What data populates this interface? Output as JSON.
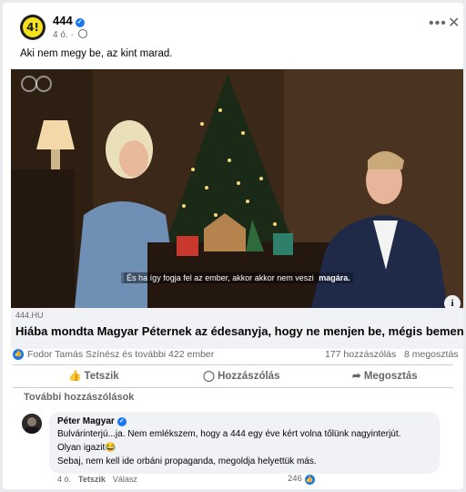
{
  "post": {
    "page_name": "444",
    "time": "4 ó.",
    "caption": "Aki nem megy be, az kint marad.",
    "logo_text": "4!",
    "more_icon": "more-dots-icon",
    "close_icon": "close-icon"
  },
  "media": {
    "subtitle_text": "És ha így fogja fel az ember, akkor akkor nem veszi ",
    "subtitle_emph": "magára."
  },
  "link": {
    "domain": "444.HU",
    "headline": "Hiába mondta Magyar Péternek az édesanyja, hogy ne menjen be, mégis bement"
  },
  "stats": {
    "reactors": "Fodor Tamás Színész és további 422 ember",
    "comments": "177 hozzászólás",
    "shares": "8 megosztás"
  },
  "actions": {
    "like": "Tetszik",
    "comment": "Hozzászólás",
    "share": "Megosztás"
  },
  "comments_section": {
    "more_label": "További hozzászólások"
  },
  "comment": {
    "author": "Péter Magyar",
    "line1": "Bulvárinterjú...ja. Nem emlékszem, hogy a 444 egy éve kért volna tőlünk nagyinterjút.",
    "line2": "Olyan igazit",
    "emoji": "😂",
    "line3": "Sebaj, nem kell ide orbáni propaganda, megoldja helyettük más.",
    "time": "4 ó.",
    "like": "Tetszik",
    "reply": "Válasz",
    "likes": "246"
  },
  "colors": {
    "accent": "#1877f2",
    "logo_yellow": "#f4e21c"
  }
}
